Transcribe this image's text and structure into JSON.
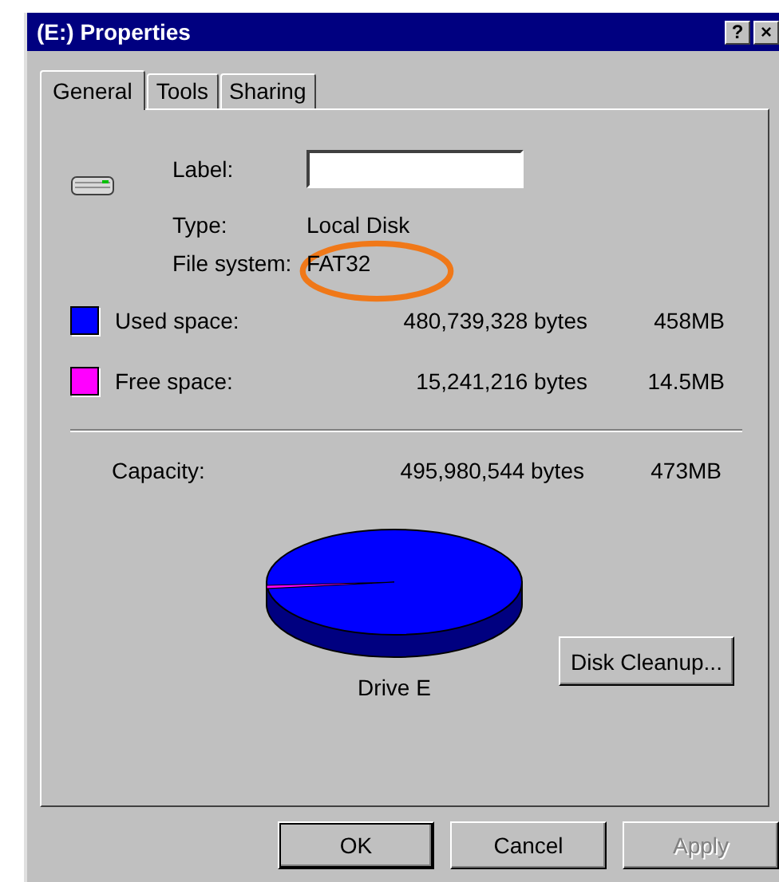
{
  "window": {
    "title": "(E:) Properties",
    "help_button": "?",
    "close_button": "×"
  },
  "tabs": [
    {
      "label": "General",
      "selected": true
    },
    {
      "label": "Tools",
      "selected": false
    },
    {
      "label": "Sharing",
      "selected": false
    }
  ],
  "drive": {
    "label_caption": "Label:",
    "type_caption": "Type:",
    "type": "Local Disk",
    "fs_caption": "File system:",
    "fs": "FAT32",
    "fs_highlighted": true
  },
  "space": [
    {
      "name": "Used space:",
      "color": "#0000ff",
      "bytes": "480,739,328 bytes",
      "size": "458MB"
    },
    {
      "name": "Free space:",
      "color": "#ff00ff",
      "bytes": "15,241,216 bytes",
      "size": "14.5MB"
    }
  ],
  "capacity": {
    "name": "Capacity:",
    "bytes": "495,980,544 bytes",
    "size": "473MB"
  },
  "pie_caption": "Drive E",
  "cleanup_button": "Disk Cleanup...",
  "buttons": [
    {
      "label": "OK",
      "default": true,
      "disabled": false
    },
    {
      "label": "Cancel",
      "default": false,
      "disabled": false
    },
    {
      "label": "Apply",
      "default": false,
      "disabled": true
    }
  ]
}
